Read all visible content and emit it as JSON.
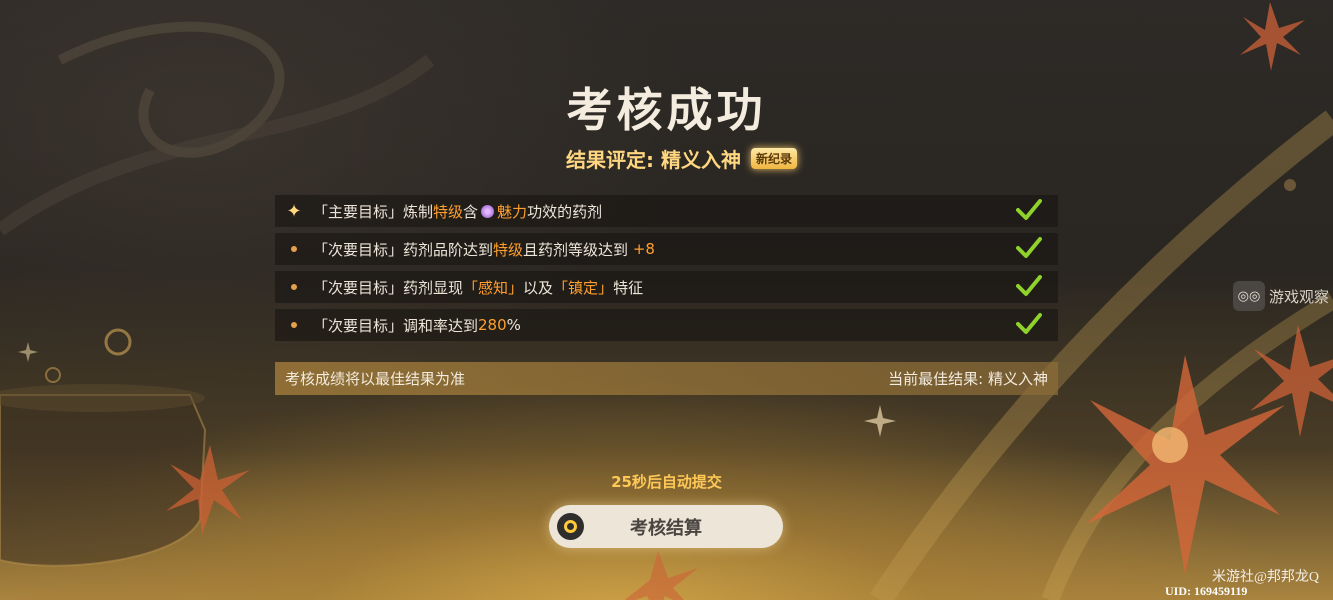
{
  "screen": {
    "title": "考核成功",
    "rating_label": "结果评定: 精义入神",
    "new_record_badge": "新纪录"
  },
  "objectives": [
    {
      "type": "primary",
      "prefix": "「主要目标」炼制",
      "highlight1": "特级",
      "middle": "含",
      "icon": "charm-icon",
      "highlight2": "魅力",
      "suffix": "功效的药剂",
      "completed": true
    },
    {
      "type": "secondary",
      "prefix": "「次要目标」药剂品阶达到",
      "highlight1": "特级",
      "middle": "且药剂等级达到 ",
      "highlight2": "+8",
      "suffix": "",
      "completed": true
    },
    {
      "type": "secondary",
      "prefix": "「次要目标」药剂显现",
      "highlight1": "「感知」",
      "middle": "以及",
      "highlight2": "「镇定」",
      "suffix": "特征",
      "completed": true
    },
    {
      "type": "secondary",
      "prefix": "「次要目标」调和率达到",
      "highlight1": "280",
      "middle": "%",
      "highlight2": "",
      "suffix": "",
      "completed": true
    }
  ],
  "footer": {
    "left_text": "考核成绩将以最佳结果为准",
    "right_text": "当前最佳结果: 精义入神"
  },
  "countdown_text": "25秒后自动提交",
  "submit_button_label": "考核结算",
  "side_button_label": "游戏观察",
  "watermark": "米游社@邦邦龙Q",
  "uid_text": "UID: 169459119",
  "colors": {
    "highlight": "#ff9f2e",
    "rating": "#ffd780",
    "check": "#8ed22b",
    "button_bg": "#ece5d8"
  }
}
